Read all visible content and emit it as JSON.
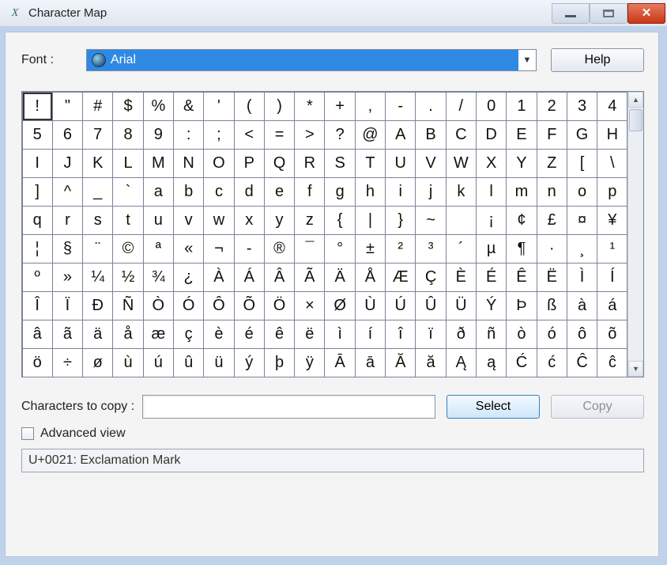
{
  "window": {
    "title": "Character Map"
  },
  "controls": {
    "min": "minimize",
    "max": "maximize",
    "close": "close"
  },
  "font": {
    "label": "Font :",
    "selected": "Arial",
    "help_label": "Help"
  },
  "grid": {
    "selected_index": 0,
    "chars": [
      "!",
      "\"",
      "#",
      "$",
      "%",
      "&",
      "'",
      "(",
      ")",
      "*",
      "+",
      ",",
      "-",
      ".",
      "/",
      "0",
      "1",
      "2",
      "3",
      "4",
      "5",
      "6",
      "7",
      "8",
      "9",
      ":",
      ";",
      "<",
      "=",
      ">",
      "?",
      "@",
      "A",
      "B",
      "C",
      "D",
      "E",
      "F",
      "G",
      "H",
      "I",
      "J",
      "K",
      "L",
      "M",
      "N",
      "O",
      "P",
      "Q",
      "R",
      "S",
      "T",
      "U",
      "V",
      "W",
      "X",
      "Y",
      "Z",
      "[",
      "\\",
      "]",
      "^",
      "_",
      "`",
      "a",
      "b",
      "c",
      "d",
      "e",
      "f",
      "g",
      "h",
      "i",
      "j",
      "k",
      "l",
      "m",
      "n",
      "o",
      "p",
      "q",
      "r",
      "s",
      "t",
      "u",
      "v",
      "w",
      "x",
      "y",
      "z",
      "{",
      "|",
      "}",
      "~",
      " ",
      "¡",
      "¢",
      "£",
      "¤",
      "¥",
      "¦",
      "§",
      "¨",
      "©",
      "ª",
      "«",
      "¬",
      "-",
      "®",
      "¯",
      "°",
      "±",
      "²",
      "³",
      "´",
      "µ",
      "¶",
      "·",
      "¸",
      "¹",
      "º",
      "»",
      "¼",
      "½",
      "¾",
      "¿",
      "À",
      "Á",
      "Â",
      "Ã",
      "Ä",
      "Å",
      "Æ",
      "Ç",
      "È",
      "É",
      "Ê",
      "Ë",
      "Ì",
      "Í",
      "Î",
      "Ï",
      "Ð",
      "Ñ",
      "Ò",
      "Ó",
      "Ô",
      "Õ",
      "Ö",
      "×",
      "Ø",
      "Ù",
      "Ú",
      "Û",
      "Ü",
      "Ý",
      "Þ",
      "ß",
      "à",
      "á",
      "â",
      "ã",
      "ä",
      "å",
      "æ",
      "ç",
      "è",
      "é",
      "ê",
      "ë",
      "ì",
      "í",
      "î",
      "ï",
      "ð",
      "ñ",
      "ò",
      "ó",
      "ô",
      "õ",
      "ö",
      "÷",
      "ø",
      "ù",
      "ú",
      "û",
      "ü",
      "ý",
      "þ",
      "ÿ",
      "Ā",
      "ā",
      "Ă",
      "ă",
      "Ą",
      "ą",
      "Ć",
      "ć",
      "Ĉ",
      "ĉ"
    ]
  },
  "copy": {
    "label": "Characters to copy :",
    "value": "",
    "placeholder": "",
    "select_label": "Select",
    "copy_label": "Copy"
  },
  "advanced": {
    "label": "Advanced view",
    "checked": false
  },
  "status": {
    "text": "U+0021: Exclamation Mark"
  }
}
